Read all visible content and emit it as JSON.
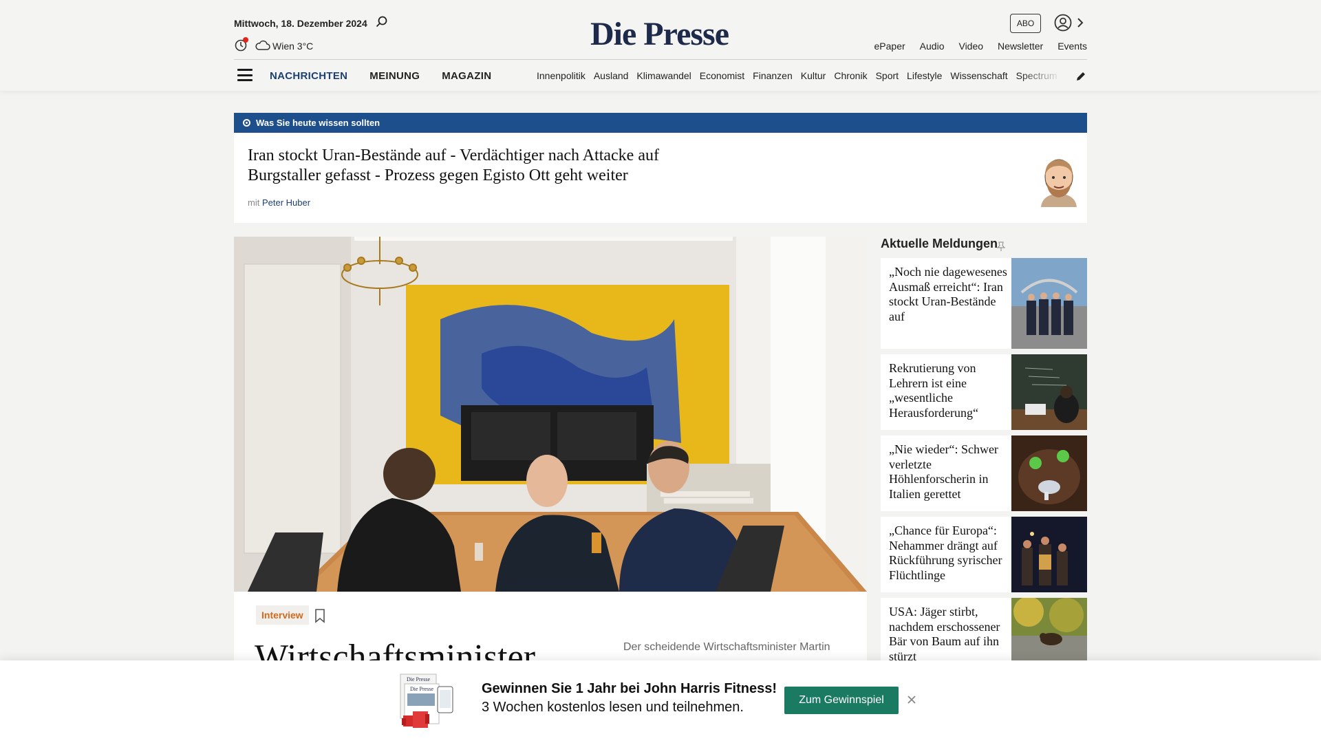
{
  "header": {
    "date": "Mittwoch, 18. Dezember 2024",
    "weather": "Wien 3°C",
    "logo": "Die Presse",
    "abo_label": "ABO",
    "top_links": [
      "ePaper",
      "Audio",
      "Video",
      "Newsletter",
      "Events"
    ],
    "main_nav": [
      "NACHRICHTEN",
      "MEINUNG",
      "MAGAZIN"
    ],
    "sub_nav": [
      "Innenpolitik",
      "Ausland",
      "Klimawandel",
      "Economist",
      "Finanzen",
      "Kultur",
      "Chronik",
      "Sport",
      "Lifestyle",
      "Wissenschaft",
      "Spectrum"
    ],
    "accent_color": "#1d3f73"
  },
  "briefing": {
    "label": "Was Sie heute wissen sollten",
    "title": "Iran stockt Uran-Bestände auf - Verdächtiger nach Attacke auf Burgstaller gefasst - Prozess gegen Egisto Ott geht weiter",
    "author_prefix": "mit",
    "author": "Peter Huber",
    "bar_color": "#1d4f8c"
  },
  "hero": {
    "tag": "Interview",
    "headline": "Wirtschaftsminister",
    "teaser": "Der scheidende Wirtschaftsminister Martin"
  },
  "sidebar": {
    "title": "Aktuelle Meldungen",
    "items": [
      {
        "text": "„Noch nie dagewesenes Ausmaß erreicht“: Iran stockt Uran-Bestände auf"
      },
      {
        "text": "Rekrutierung von Lehrern ist eine „wesentliche Herausforderung“"
      },
      {
        "text": "„Nie wieder“: Schwer verletzte Höhlenforscherin in Italien gerettet"
      },
      {
        "text": "„Chance für Europa“: Nehammer drängt auf Rückführung syrischer Flüchtlinge"
      },
      {
        "text": "USA: Jäger stirbt, nachdem erschossener Bär von Baum auf ihn stürzt"
      }
    ]
  },
  "promo": {
    "title": "Gewinnen Sie 1 Jahr bei John Harris Fitness!",
    "subtitle": "3 Wochen kostenlos lesen und teilnehmen.",
    "button": "Zum Gewinnspiel",
    "button_color": "#1a7a62",
    "brand_mini": "Die Presse"
  }
}
